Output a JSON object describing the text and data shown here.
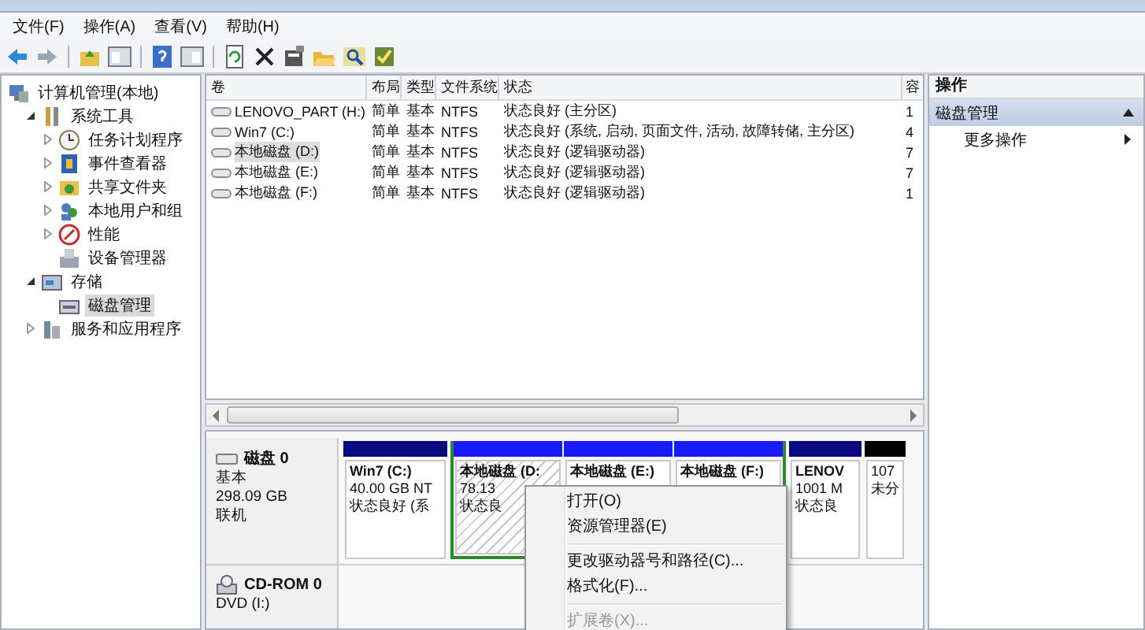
{
  "menu_bar": [
    "文件(F)",
    "操作(A)",
    "查看(V)",
    "帮助(H)"
  ],
  "tree": [
    {
      "label": "计算机管理(本地)",
      "selected": false,
      "children": [
        {
          "label": "系统工具",
          "expanded": true,
          "selected": false,
          "children": [
            {
              "label": "任务计划程序",
              "expanded": false,
              "selected": false
            },
            {
              "label": "事件查看器",
              "expanded": false,
              "selected": false
            },
            {
              "label": "共享文件夹",
              "expanded": false,
              "selected": false
            },
            {
              "label": "本地用户和组",
              "expanded": false,
              "selected": false
            },
            {
              "label": "性能",
              "expanded": false,
              "selected": false
            },
            {
              "label": "设备管理器",
              "selected": false
            }
          ]
        },
        {
          "label": "存储",
          "expanded": true,
          "selected": false,
          "children": [
            {
              "label": "磁盘管理",
              "selected": true
            }
          ]
        },
        {
          "label": "服务和应用程序",
          "expanded": false,
          "selected": false
        }
      ]
    }
  ],
  "volumes": {
    "columns": [
      "卷",
      "布局",
      "类型",
      "文件系统",
      "状态",
      "容"
    ],
    "rows": [
      {
        "cells": [
          "LENOVO_PART (H:)",
          "简单",
          "基本",
          "NTFS",
          "状态良好 (主分区)",
          "1"
        ],
        "selected": false
      },
      {
        "cells": [
          "Win7 (C:)",
          "简单",
          "基本",
          "NTFS",
          "状态良好 (系统, 启动, 页面文件, 活动, 故障转储, 主分区)",
          "4"
        ],
        "selected": false
      },
      {
        "cells": [
          "本地磁盘 (D:)",
          "简单",
          "基本",
          "NTFS",
          "状态良好 (逻辑驱动器)",
          "7"
        ],
        "selected": true
      },
      {
        "cells": [
          "本地磁盘 (E:)",
          "简单",
          "基本",
          "NTFS",
          "状态良好 (逻辑驱动器)",
          "7"
        ],
        "selected": false
      },
      {
        "cells": [
          "本地磁盘 (F:)",
          "简单",
          "基本",
          "NTFS",
          "状态良好 (逻辑驱动器)",
          "1"
        ],
        "selected": false
      }
    ]
  },
  "disks": [
    {
      "kind": "disk",
      "name": "磁盘 0",
      "lines": [
        "基本",
        "298.09 GB",
        "联机"
      ],
      "partitions": [
        {
          "kind": "primary",
          "title": "Win7  (C:)",
          "lines": [
            "40.00 GB NT",
            "状态良好 (系"
          ],
          "selected": false
        },
        {
          "kind": "extended",
          "children": [
            {
              "kind": "logical",
              "title": "本地磁盘  (D:",
              "lines": [
                "78.13",
                "状态良"
              ],
              "selected": true
            },
            {
              "kind": "logical",
              "title": "本地磁盘  (E:)",
              "selected": false
            },
            {
              "kind": "logical",
              "title": "本地磁盘  (F:)",
              "selected": false
            }
          ]
        },
        {
          "kind": "primary",
          "title": "LENOV",
          "lines": [
            "1001 M",
            "状态良"
          ],
          "selected": false
        },
        {
          "kind": "unallocated",
          "lines": [
            "107",
            "未分"
          ],
          "selected": false
        }
      ]
    },
    {
      "kind": "cdrom",
      "name": "CD-ROM 0",
      "lines": [
        "DVD (I:)"
      ]
    }
  ],
  "actions": {
    "title": "操作",
    "sections": [
      {
        "label": "磁盘管理",
        "items": [
          "更多操作"
        ]
      }
    ]
  },
  "context_menu": [
    [
      {
        "label": "打开(O)",
        "disabled": false
      },
      {
        "label": "资源管理器(E)",
        "disabled": false
      }
    ],
    [
      {
        "label": "更改驱动器号和路径(C)...",
        "disabled": false
      },
      {
        "label": "格式化(F)...",
        "disabled": false
      }
    ],
    [
      {
        "label": "扩展卷(X)...",
        "disabled": true
      }
    ]
  ]
}
